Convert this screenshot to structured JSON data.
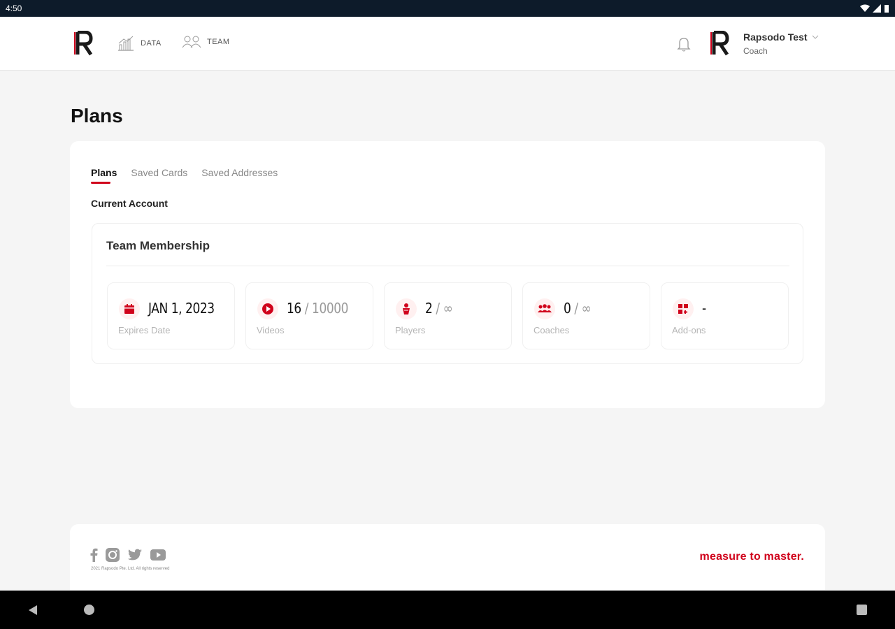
{
  "status_bar": {
    "time": "4:50"
  },
  "nav": {
    "items": [
      {
        "label": "DATA",
        "icon": "chart-icon"
      },
      {
        "label": "TEAM",
        "icon": "team-icon"
      }
    ],
    "user": {
      "name": "Rapsodo Test",
      "role": "Coach"
    }
  },
  "page": {
    "title": "Plans"
  },
  "tabs": [
    {
      "label": "Plans",
      "active": true
    },
    {
      "label": "Saved Cards",
      "active": false
    },
    {
      "label": "Saved Addresses",
      "active": false
    }
  ],
  "section_label": "Current Account",
  "membership": {
    "title": "Team Membership",
    "stats": [
      {
        "icon": "calendar-icon",
        "value": "JAN 1, 2023",
        "total": "",
        "label": "Expires Date"
      },
      {
        "icon": "play-icon",
        "value": "16",
        "total": "/ 10000",
        "label": "Videos"
      },
      {
        "icon": "player-icon",
        "value": "2",
        "total": "/ ∞",
        "label": "Players"
      },
      {
        "icon": "coaches-icon",
        "value": "0",
        "total": "/ ∞",
        "label": "Coaches"
      },
      {
        "icon": "addons-icon",
        "value": "-",
        "total": "",
        "label": "Add-ons"
      }
    ]
  },
  "footer": {
    "copyright": "2021 Rapsodo Pte. Ltd. All rights reserved",
    "tagline": "measure to master.",
    "socials": [
      "facebook-icon",
      "instagram-icon",
      "twitter-icon",
      "youtube-icon"
    ]
  },
  "colors": {
    "accent": "#d0021b",
    "background": "#f5f5f5",
    "status_bar": "#0d1b2a"
  }
}
